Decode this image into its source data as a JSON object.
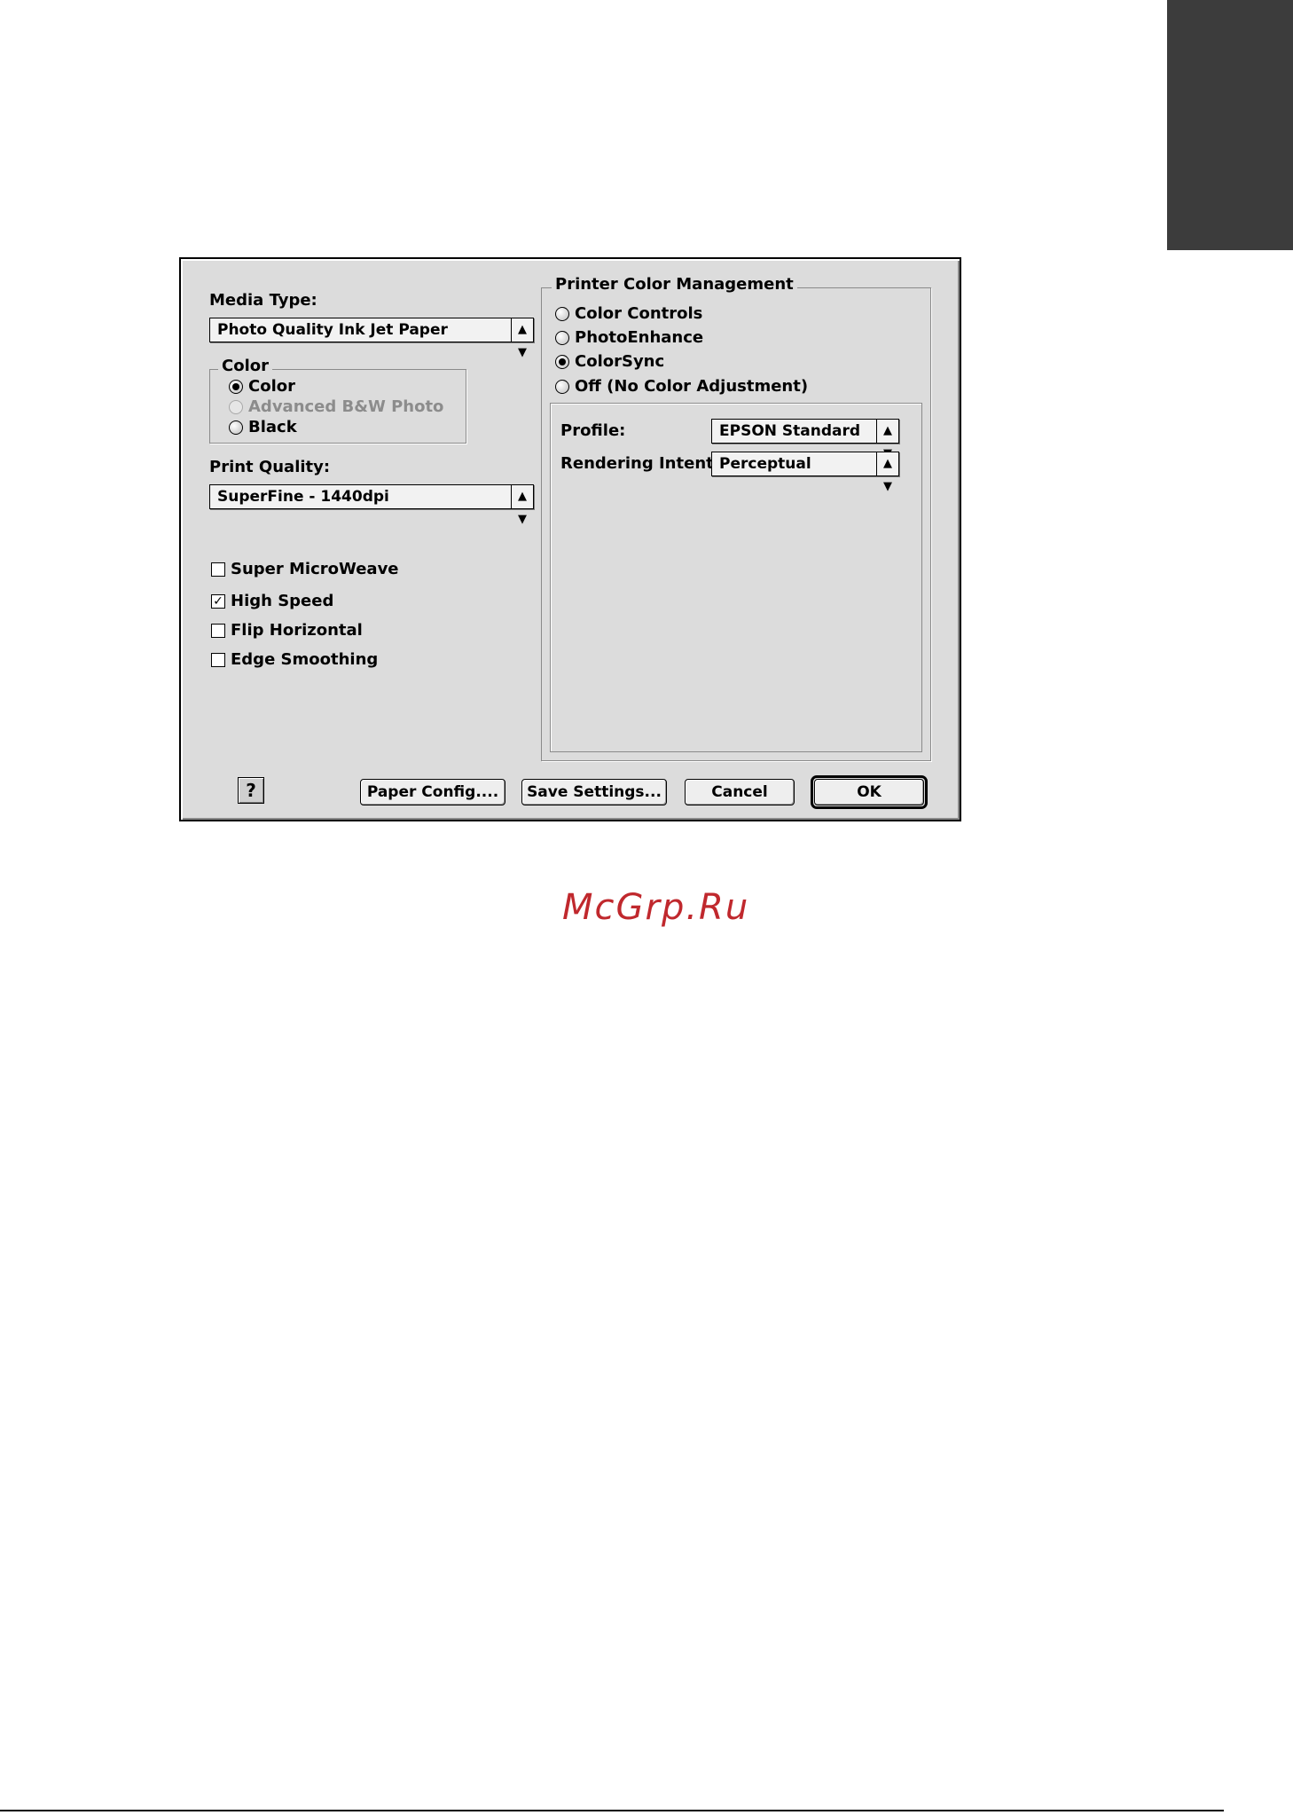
{
  "left": {
    "media_type_label": "Media Type:",
    "media_type_value": "Photo Quality Ink Jet Paper",
    "color_group_title": "Color",
    "color_options": [
      {
        "label": "Color",
        "selected": true,
        "enabled": true
      },
      {
        "label": "Advanced B&W Photo",
        "selected": false,
        "enabled": false
      },
      {
        "label": "Black",
        "selected": false,
        "enabled": true
      }
    ],
    "print_quality_label": "Print Quality:",
    "print_quality_value": "SuperFine - 1440dpi",
    "checkboxes": [
      {
        "label": "Super MicroWeave",
        "checked": false
      },
      {
        "label": "High Speed",
        "checked": true
      },
      {
        "label": "Flip Horizontal",
        "checked": false
      },
      {
        "label": "Edge Smoothing",
        "checked": false
      }
    ]
  },
  "right": {
    "group_title": "Printer Color Management",
    "options": [
      {
        "label": "Color Controls",
        "selected": false
      },
      {
        "label": "PhotoEnhance",
        "selected": false
      },
      {
        "label": "ColorSync",
        "selected": true
      },
      {
        "label": "Off (No Color Adjustment)",
        "selected": false
      }
    ],
    "profile_label": "Profile:",
    "profile_value": "EPSON Standard",
    "rendering_intent_label": "Rendering Intent:",
    "rendering_intent_value": "Perceptual"
  },
  "buttons": {
    "help": "?",
    "paper_config": "Paper Config....",
    "save_settings": "Save Settings...",
    "cancel": "Cancel",
    "ok": "OK"
  },
  "watermark": "McGrp.Ru",
  "colors": {
    "dialog_bg": "#dcdcdc",
    "tab_block": "#3c3c3c",
    "watermark": "#c0282d"
  }
}
